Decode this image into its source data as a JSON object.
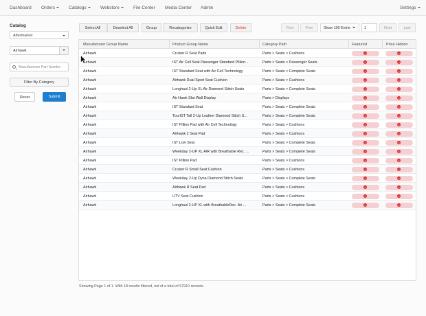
{
  "nav": {
    "items": [
      {
        "label": "Dashboard",
        "dropdown": false
      },
      {
        "label": "Orders",
        "dropdown": true
      },
      {
        "label": "Catalogs",
        "dropdown": true
      },
      {
        "label": "Webstore",
        "dropdown": true
      },
      {
        "label": "File Center",
        "dropdown": false
      },
      {
        "label": "Media Center",
        "dropdown": false
      },
      {
        "label": "Admin",
        "dropdown": false
      }
    ],
    "settings": "Settings"
  },
  "sidebar": {
    "title": "Catalog",
    "catalog_select": "Aftermarket",
    "manufacturer_select": "Airhawk",
    "part_search_placeholder": "Manufacturer Part Numbe",
    "filter_button": "Filter By Category",
    "reset_button": "Reset",
    "submit_button": "Submit"
  },
  "toolbar": {
    "buttons": [
      "Select All",
      "Deselect All",
      "Group",
      "Recategorize",
      "Quick Edit",
      "Delete"
    ],
    "pagination": {
      "first": "First",
      "prev": "Prev",
      "show_entries": "Show 100 Entrie",
      "page": "1",
      "next": "Next",
      "last": "Last"
    }
  },
  "table": {
    "headers": [
      "Manufacturer Group Name",
      "Product Group Name",
      "Category Path",
      "Featured",
      "Price Hidden"
    ],
    "rows": [
      [
        "Airhawk",
        "Cruiser R Seat Pads",
        "Parts > Seats > Cushions"
      ],
      [
        "Airhawk",
        "IST Air Cell Seat Passenger Standard Pillion...",
        "Parts > Seats > Passenger Seats"
      ],
      [
        "Airhawk",
        "IST Standard Seat with Air Cell Technology",
        "Parts > Seats > Complete Seats"
      ],
      [
        "Airhawk",
        "Airhawk Dual Sport Seat Cushion",
        "Parts > Seats > Cushions"
      ],
      [
        "Airhawk",
        "Longhaul 2-Up XL Air Diamond Stitch Seats",
        "Parts > Seats > Complete Seats"
      ],
      [
        "Airhawk",
        "Air Hawk Slat Wall Display",
        "Parts > Displays"
      ],
      [
        "Airhawk",
        "IST Standard Seat",
        "Parts > Seats > Complete Seats"
      ],
      [
        "Airhawk",
        "TourIST Tall 2-Up Leather Diamond Stitch S...",
        "Parts > Seats > Complete Seats"
      ],
      [
        "Airhawk",
        "IST Pillion Pad with Air Cell Technology",
        "Parts > Seats > Cushions"
      ],
      [
        "Airhawk",
        "Airhawk 2 Seat Pad",
        "Parts > Seats > Cushions"
      ],
      [
        "Airhawk",
        "IST Low Seat",
        "Parts > Seats > Complete Seats"
      ],
      [
        "Airhawk",
        "Weekday 2-UP XL AIR with Breathable Rec. ...",
        "Parts > Seats > Complete Seats"
      ],
      [
        "Airhawk",
        "IST Pillion Pad",
        "Parts > Seats > Cushions"
      ],
      [
        "Airhawk",
        "Cruiser R Small Seat Cushion",
        "Parts > Seats > Cushions"
      ],
      [
        "Airhawk",
        "Weekday 2-Up Dyna Diamond Stitch Seats",
        "Parts > Seats > Complete Seats"
      ],
      [
        "Airhawk",
        "Airhawk R Seat Pad",
        "Parts > Seats > Cushions"
      ],
      [
        "Airhawk",
        "UTV Seat Cushion",
        "Parts > Seats > Cushions"
      ],
      [
        "Airhawk",
        "Longhaul 2-UP XL with BreathableRec. Air ...",
        "Parts > Seats > Complete Seats"
      ]
    ]
  },
  "footer": {
    "summary": "Showing Page 1 of 1. With 18 results filtered, out of a total of 57910 records."
  },
  "icons": {
    "featured": "x-circle-icon",
    "price_hidden": "x-circle-icon"
  },
  "colors": {
    "accent": "#1f7fcf",
    "delete": "#dd3333",
    "status_bad": "#d63031",
    "status_bad_bg": "#f6cfd2"
  }
}
